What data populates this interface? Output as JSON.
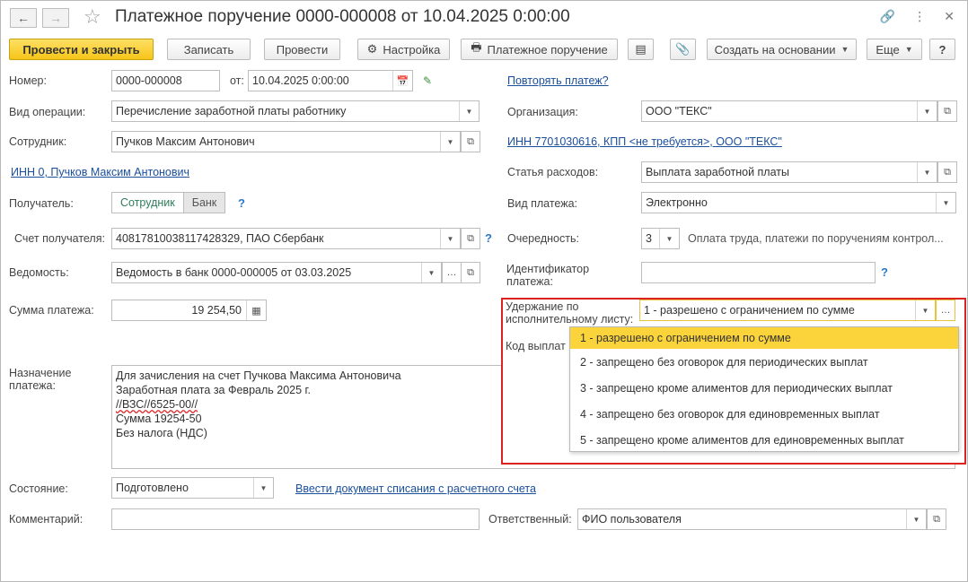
{
  "window": {
    "title": "Платежное поручение 0000-000008 от 10.04.2025 0:00:00"
  },
  "toolbar": {
    "post_close": "Провести и закрыть",
    "write": "Записать",
    "post": "Провести",
    "settings": "Настройка",
    "payment_order": "Платежное поручение",
    "create_based": "Создать на основании",
    "more": "Еще",
    "help": "?"
  },
  "form": {
    "number": {
      "label": "Номер:",
      "value": "0000-000008"
    },
    "date": {
      "label": "от:",
      "value": "10.04.2025  0:00:00"
    },
    "repeat_link": "Повторять платеж?",
    "operation": {
      "label": "Вид операции:",
      "value": "Перечисление заработной платы работнику"
    },
    "organization": {
      "label": "Организация:",
      "value": "ООО \"ТЕКС\""
    },
    "employee": {
      "label": "Сотрудник:",
      "value": "Пучков Максим Антонович"
    },
    "org_inn_link": "ИНН 7701030616, КПП <не требуется>, ООО \"ТЕКС\"",
    "employee_inn_link": "ИНН 0, Пучков Максим Антонович",
    "expense": {
      "label": "Статья расходов:",
      "value": "Выплата заработной платы"
    },
    "recipient": {
      "label": "Получатель:",
      "opt_employee": "Сотрудник",
      "opt_bank": "Банк",
      "help": "?"
    },
    "payment_type": {
      "label": "Вид платежа:",
      "value": "Электронно"
    },
    "account": {
      "label": "Счет получателя:",
      "value": "40817810038117428329, ПАО Сбербанк",
      "help": "?"
    },
    "priority": {
      "label": "Очередность:",
      "value": "3",
      "text": "Оплата труда, платежи по поручениям контрол..."
    },
    "statement": {
      "label": "Ведомость:",
      "value": "Ведомость в банк 0000-000005 от 03.03.2025"
    },
    "payment_id": {
      "label": "Идентификатор платежа:",
      "value": "",
      "help": "?"
    },
    "amount": {
      "label": "Сумма платежа:",
      "value": "19 254,50"
    },
    "withholding": {
      "label": "Удержание по исполнительному листу:",
      "value": "1 - разрешено с ограничением по сумме"
    },
    "income_code": {
      "label": "Код выплат"
    },
    "purpose": {
      "label": "Назначение платежа:",
      "lines": [
        "Для зачисления на счет Пучкова Максима Антоновича",
        "Заработная плата за Февраль 2025 г.",
        "//ВЗС//6525-00//",
        "Сумма 19254-50",
        "Без налога (НДС)"
      ]
    },
    "state": {
      "label": "Состояние:",
      "value": "Подготовлено"
    },
    "write_off_link": "Ввести документ списания с расчетного счета",
    "comment": {
      "label": "Комментарий:",
      "value": ""
    },
    "responsible": {
      "label": "Ответственный:",
      "value": "ФИО пользователя"
    }
  },
  "dropdown": {
    "options": [
      "1 - разрешено с ограничением по сумме",
      "2 - запрещено без оговорок для периодических выплат",
      "3 - запрещено кроме алиментов для периодических выплат",
      "4 - запрещено без оговорок для единовременных выплат",
      "5 - запрещено кроме алиментов для единовременных выплат"
    ],
    "selected_index": 0
  },
  "colors": {
    "primary_button": "#f5c518",
    "link": "#1a4f9c",
    "highlight_border": "#dd2222",
    "selected_option": "#fbd33b"
  }
}
